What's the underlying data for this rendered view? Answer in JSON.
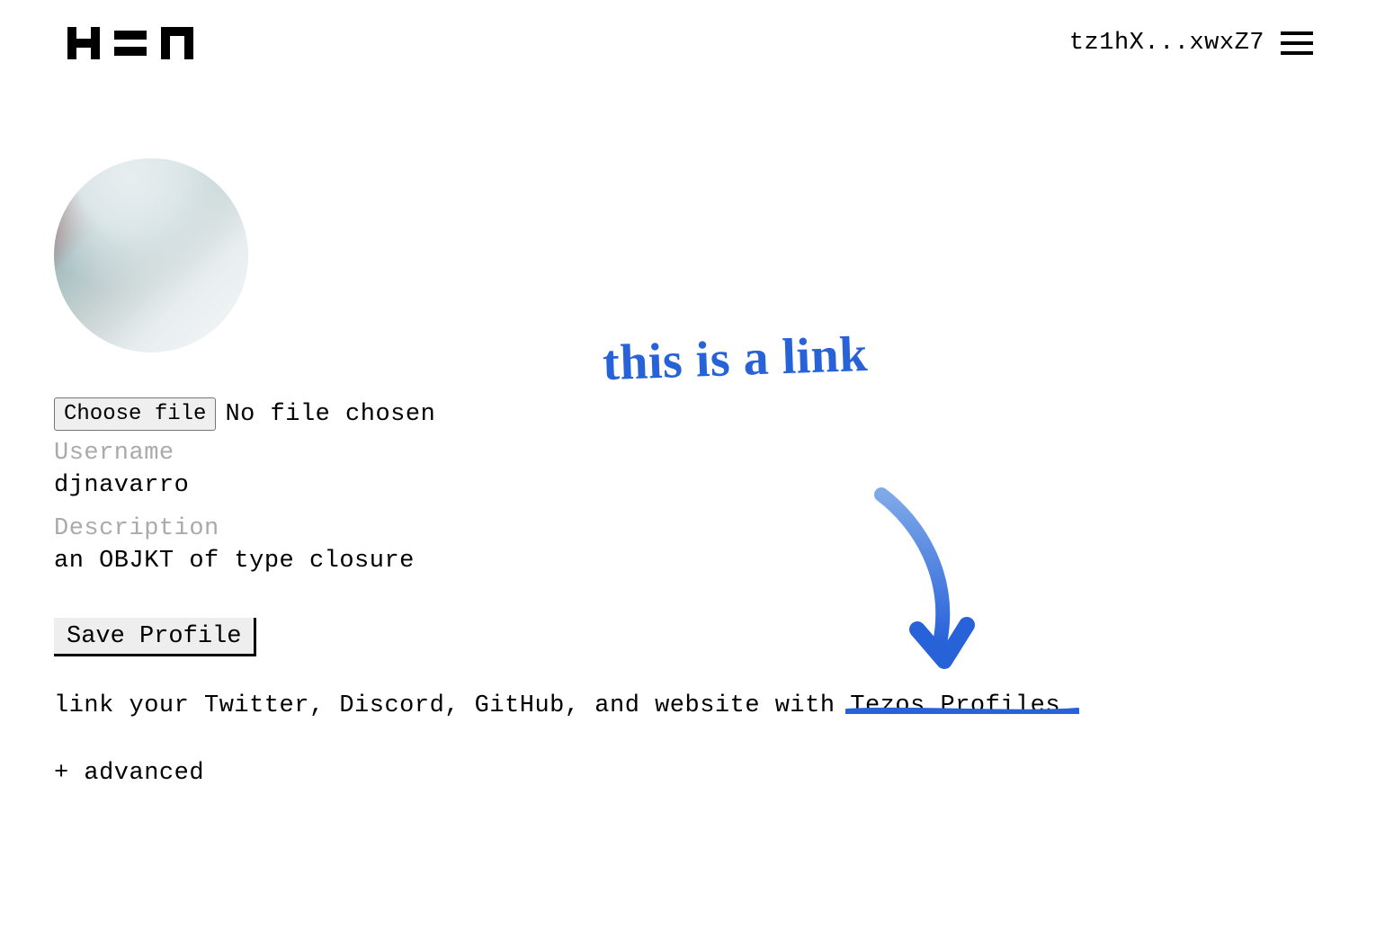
{
  "header": {
    "logo_alt": "HEN",
    "wallet": "tz1hX...xwxZ7"
  },
  "profile": {
    "choose_file_label": "Choose file",
    "file_status": "No file chosen",
    "username_label": "Username",
    "username_value": "djnavarro",
    "description_label": "Description",
    "description_value": "an OBJKT of type closure",
    "save_label": "Save Profile",
    "link_text_prefix": "link your Twitter, Discord, GitHub, and website with ",
    "tezos_link_label": "Tezos Profiles",
    "advanced_label": "+ advanced"
  },
  "annotation": {
    "text": "this is a\nlink"
  }
}
